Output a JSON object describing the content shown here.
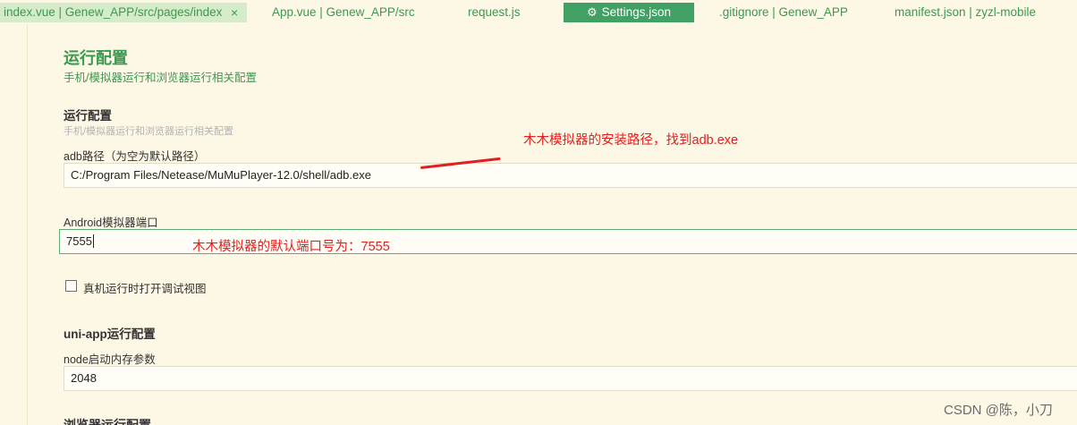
{
  "tabs": [
    {
      "label": "index.vue | Genew_APP/src/pages/index",
      "close": "×"
    },
    {
      "label": "App.vue | Genew_APP/src"
    },
    {
      "label": "request.js"
    },
    {
      "label": "Settings.json"
    },
    {
      "label": ".gitignore | Genew_APP"
    },
    {
      "label": "manifest.json | zyzl-mobile"
    }
  ],
  "section": {
    "title": "运行配置",
    "subtitle": "手机/模拟器运行和浏览器运行相关配置"
  },
  "run_config": {
    "title": "运行配置",
    "subtitle": "手机/模拟器运行和浏览器运行相关配置",
    "adb_label": "adb路径（为空为默认路径）",
    "adb_value": "C:/Program Files/Netease/MuMuPlayer-12.0/shell/adb.exe",
    "port_label": "Android模拟器端口",
    "port_value": "7555",
    "debug_checkbox_label": "真机运行时打开调试视图",
    "debug_checked": false
  },
  "uniapp_config": {
    "title": "uni-app运行配置",
    "node_label": "node启动内存参数",
    "node_value": "2048"
  },
  "browser_config": {
    "title": "浏览器运行配置"
  },
  "annotations": {
    "adb_note": "木木模拟器的安装路径，找到adb.exe",
    "port_note": "木木模拟器的默认端口号为：7555"
  },
  "watermark": "CSDN @陈，小刀",
  "colors": {
    "background": "#fdf7e6",
    "accent_green": "#3a9a4f",
    "active_tab": "#41a063",
    "annotation_red": "#e02020"
  }
}
